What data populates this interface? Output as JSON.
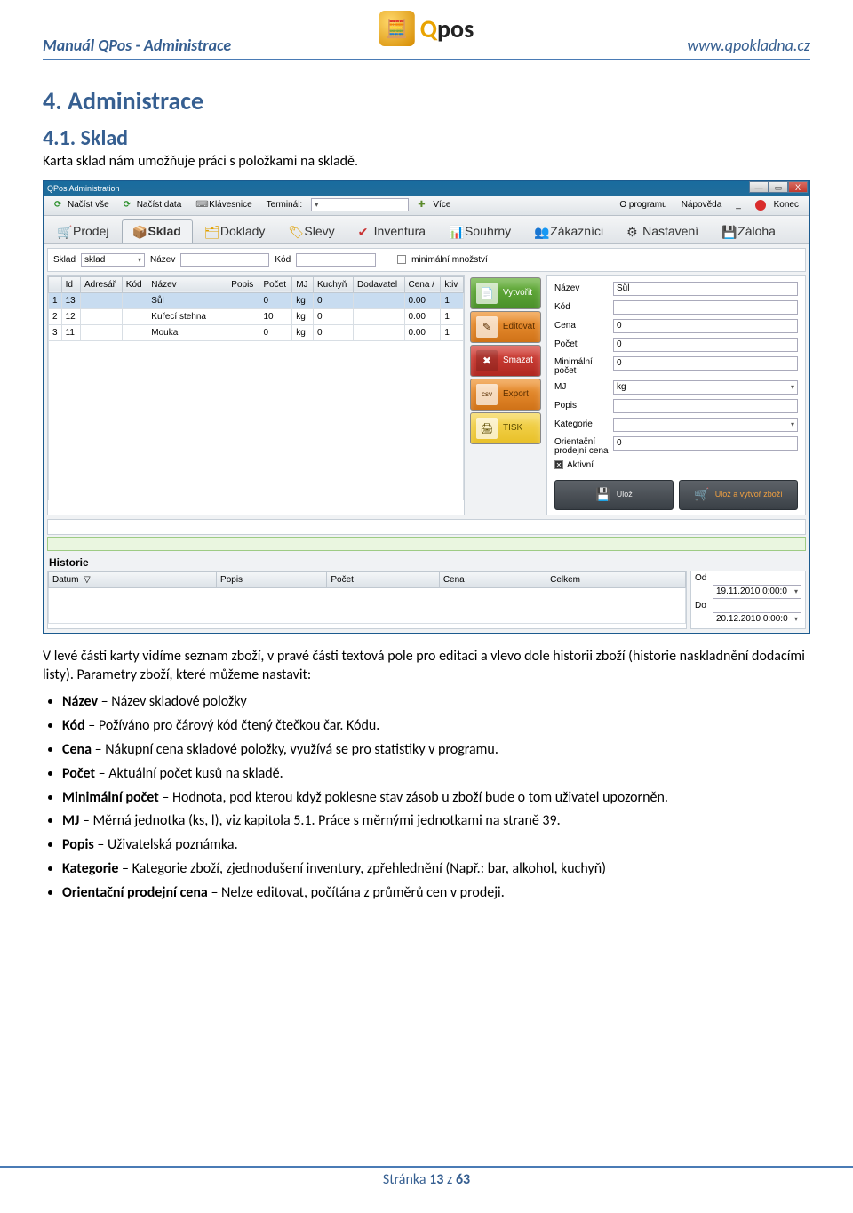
{
  "doc": {
    "header_left": "Manuál QPos - Administrace",
    "header_right": "www.qpokladna.cz",
    "logo_text_q": "Q",
    "logo_text_rest": "pos",
    "h1": "4.   Administrace",
    "h2": "4.1.   Sklad",
    "intro": "Karta sklad nám umožňuje práci s položkami na skladě.",
    "after_img": "V levé části karty vidíme seznam zboží, v pravé části textová pole pro editaci a vlevo dole historii zboží (historie naskladnění dodacími listy). Parametry zboží, které můžeme nastavit:",
    "bullets": [
      {
        "b": "Název",
        "t": " – Název skladové položky"
      },
      {
        "b": "Kód",
        "t": " – Požíváno pro čárový kód čtený čtečkou čar. Kódu."
      },
      {
        "b": "Cena",
        "t": " – Nákupní cena skladové položky, využívá se pro statistiky v programu."
      },
      {
        "b": "Počet",
        "t": " – Aktuální počet kusů na skladě."
      },
      {
        "b": "Minimální počet",
        "t": " – Hodnota, pod kterou když poklesne stav zásob u zboží bude o tom uživatel upozorněn."
      },
      {
        "b": "MJ",
        "t": " – Měrná jednotka (ks, l), viz kapitola 5.1. Práce s měrnými jednotkami na straně 39."
      },
      {
        "b": "Popis",
        "t": " – Uživatelská poznámka."
      },
      {
        "b": "Kategorie",
        "t": " – Kategorie zboží, zjednodušení inventury, zpřehlednění (Např.: bar, alkohol, kuchyň)"
      },
      {
        "b": "Orientační prodejní cena",
        "t": " – Nelze editovat, počítána z průměrů cen v prodeji."
      }
    ],
    "footer_page_pre": "Stránka ",
    "footer_page_num": "13",
    "footer_page_mid": " z ",
    "footer_page_total": "63"
  },
  "app": {
    "title": "QPos Administration",
    "toolbar": {
      "nacist_vse": "Načíst vše",
      "nacist_data": "Načíst data",
      "klavesnice": "Klávesnice",
      "terminal": "Terminál:",
      "vice": "Více",
      "o_programu": "O programu",
      "napoveda": "Nápověda",
      "konec": "Konec"
    },
    "tabs": {
      "prodej": "Prodej",
      "sklad": "Sklad",
      "doklady": "Doklady",
      "slevy": "Slevy",
      "inventura": "Inventura",
      "souhrny": "Souhrny",
      "zakaznici": "Zákazníci",
      "nastaveni": "Nastavení",
      "zaloha": "Záloha"
    },
    "filter": {
      "sklad_label": "Sklad",
      "sklad_value": "sklad",
      "nazev_label": "Název",
      "kod_label": "Kód",
      "min_mnozstvi": "minimální množství"
    },
    "grid": {
      "cols": {
        "id": "Id",
        "adresar": "Adresář",
        "kod": "Kód",
        "nazev": "Název",
        "popis": "Popis",
        "pocet": "Počet",
        "mj": "MJ",
        "kuchyn": "Kuchyň",
        "dodavatel": "Dodavatel",
        "cena": "Cena /",
        "ktiv": "ktiv"
      },
      "rows": [
        {
          "n": "1",
          "id": "13",
          "adresar": "",
          "kod": "",
          "nazev": "Sůl",
          "popis": "",
          "pocet": "0",
          "mj": "kg",
          "kuchyn": "0",
          "dodavatel": "",
          "cena": "0.00",
          "ktiv": "1"
        },
        {
          "n": "2",
          "id": "12",
          "adresar": "",
          "kod": "",
          "nazev": "Kuřecí stehna",
          "popis": "",
          "pocet": "10",
          "mj": "kg",
          "kuchyn": "0",
          "dodavatel": "",
          "cena": "0.00",
          "ktiv": "1"
        },
        {
          "n": "3",
          "id": "11",
          "adresar": "",
          "kod": "",
          "nazev": "Mouka",
          "popis": "",
          "pocet": "0",
          "mj": "kg",
          "kuchyn": "0",
          "dodavatel": "",
          "cena": "0.00",
          "ktiv": "1"
        }
      ]
    },
    "actions": {
      "vytvorit": "Vytvořit",
      "editovat": "Editovat",
      "smazat": "Smazat",
      "export": "Export",
      "tisk": "TISK"
    },
    "form": {
      "nazev_l": "Název",
      "nazev_v": "Sůl",
      "kod_l": "Kód",
      "kod_v": "",
      "cena_l": "Cena",
      "cena_v": "0",
      "pocet_l": "Počet",
      "pocet_v": "0",
      "minpocet_l": "Minimální počet",
      "minpocet_v": "0",
      "mj_l": "MJ",
      "mj_v": "kg",
      "popis_l": "Popis",
      "popis_v": "",
      "kategorie_l": "Kategorie",
      "kategorie_v": "",
      "orient_l": "Orientační prodejní cena",
      "orient_v": "0",
      "aktivni": "Aktivní",
      "uloz": "Ulož",
      "uloz_vytvor": "Ulož a vytvoř zboží"
    },
    "history": {
      "title": "Historie",
      "cols": {
        "datum": "Datum",
        "popis": "Popis",
        "pocet": "Počet",
        "cena": "Cena",
        "celkem": "Celkem"
      },
      "od_l": "Od",
      "od_v": "19.11.2010 0:00:0",
      "do_l": "Do",
      "do_v": "20.12.2010 0:00:0"
    }
  }
}
